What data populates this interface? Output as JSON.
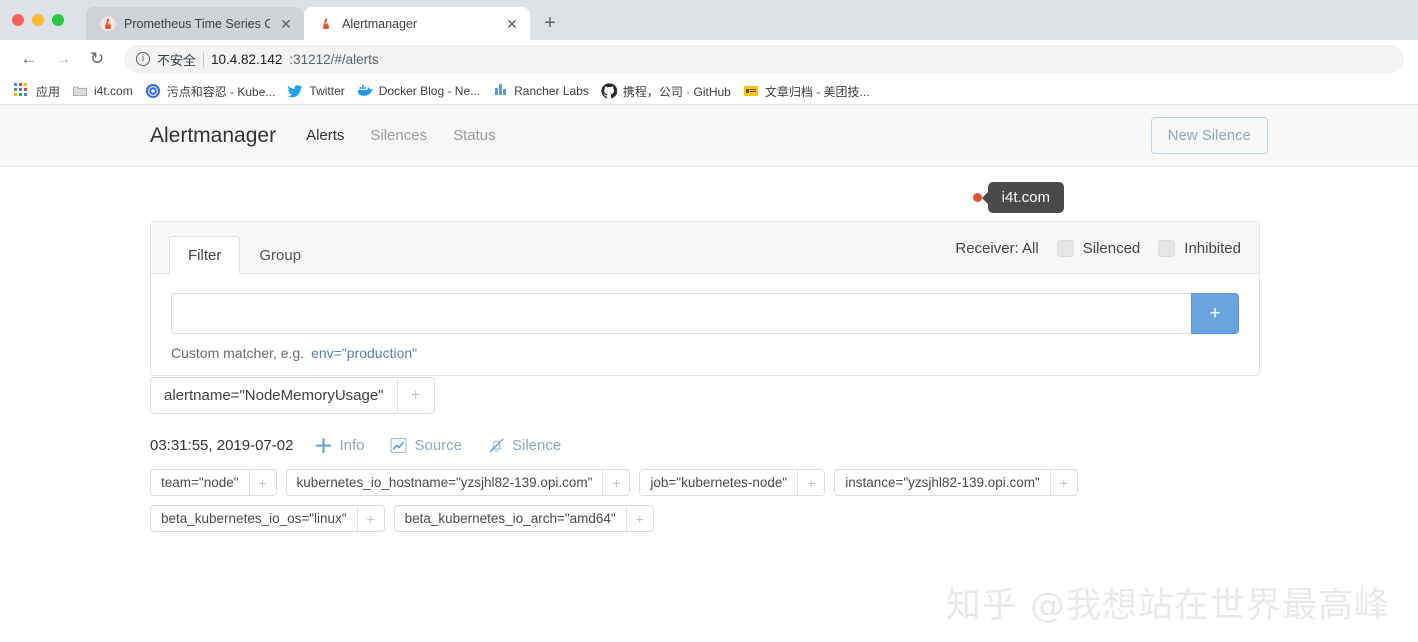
{
  "browser": {
    "tabs": [
      {
        "title": "Prometheus Time Series Collec",
        "favicon": "prometheus-flame-icon",
        "active": false,
        "close_label": "✕"
      },
      {
        "title": "Alertmanager",
        "favicon": "prometheus-flame-icon",
        "active": true,
        "close_label": "✕"
      }
    ],
    "new_tab_label": "+",
    "nav": {
      "back_label": "←",
      "forward_label": "→",
      "reload_label": "↻"
    },
    "omnibox": {
      "info_glyph": "i",
      "security_text": "不安全",
      "url_host": "10.4.82.142",
      "url_rest": ":31212/#/alerts"
    },
    "bookmarks": [
      {
        "label": "应用",
        "icon": "apps-grid-icon"
      },
      {
        "label": "i4t.com",
        "icon": "folder-icon"
      },
      {
        "label": "污点和容忍 - Kube...",
        "icon": "kubernetes-icon"
      },
      {
        "label": "Twitter",
        "icon": "twitter-bird-icon"
      },
      {
        "label": "Docker Blog - Ne...",
        "icon": "docker-whale-icon"
      },
      {
        "label": "Rancher Labs",
        "icon": "rancher-icon"
      },
      {
        "label": "携程，公司 · GitHub",
        "icon": "github-icon"
      },
      {
        "label": "文章归档 - 美团技...",
        "icon": "meituan-icon"
      }
    ]
  },
  "app": {
    "brand": "Alertmanager",
    "nav_links": [
      {
        "label": "Alerts",
        "active": true
      },
      {
        "label": "Silences",
        "active": false
      },
      {
        "label": "Status",
        "active": false
      }
    ],
    "new_silence_button": "New Silence"
  },
  "tooltip": {
    "text": "i4t.com",
    "dot_color": "#e8502b",
    "bg_color": "#4a4a4a"
  },
  "filter_panel": {
    "tabs": [
      {
        "label": "Filter",
        "active": true
      },
      {
        "label": "Group",
        "active": false
      }
    ],
    "receiver_label": "Receiver: All",
    "checkboxes": [
      {
        "label": "Silenced",
        "checked": false
      },
      {
        "label": "Inhibited",
        "checked": false
      }
    ],
    "matcher_input_value": "",
    "matcher_input_placeholder": "",
    "add_button_label": "+",
    "hint_prefix": "Custom matcher, e.g.",
    "hint_code": "env=\"production\""
  },
  "alert": {
    "group_chip": {
      "text": "alertname=\"NodeMemoryUsage\"",
      "plus": "+"
    },
    "timestamp": "03:31:55, 2019-07-02",
    "actions": [
      {
        "label": "Info",
        "icon": "plus-icon"
      },
      {
        "label": "Source",
        "icon": "chart-line-icon"
      },
      {
        "label": "Silence",
        "icon": "bell-slash-icon"
      }
    ],
    "labels_row1": [
      {
        "text": "team=\"node\"",
        "plus": "+"
      },
      {
        "text": "kubernetes_io_hostname=\"yzsjhl82-139.opi.com\"",
        "plus": "+"
      },
      {
        "text": "job=\"kubernetes-node\"",
        "plus": "+"
      },
      {
        "text": "instance=\"yzsjhl82-139.opi.com\"",
        "plus": "+"
      }
    ],
    "labels_row2": [
      {
        "text": "beta_kubernetes_io_os=\"linux\"",
        "plus": "+"
      },
      {
        "text": "beta_kubernetes_io_arch=\"amd64\"",
        "plus": "+"
      }
    ]
  },
  "watermark": "知乎 @我想站在世界最高峰"
}
